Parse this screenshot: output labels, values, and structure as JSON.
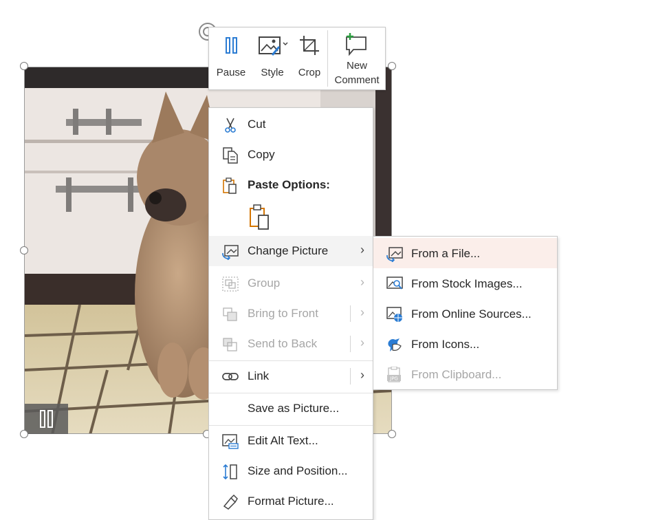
{
  "toolbar": {
    "pause_label": "Pause",
    "style_label": "Style",
    "crop_label": "Crop",
    "new_comment_line1": "New",
    "new_comment_line2": "Comment"
  },
  "context_menu": {
    "cut": "Cut",
    "copy": "Copy",
    "paste_options": "Paste Options:",
    "change_picture": "Change Picture",
    "group": "Group",
    "bring_to_front": "Bring to Front",
    "send_to_back": "Send to Back",
    "link": "Link",
    "save_as_picture": "Save as Picture...",
    "edit_alt_text": "Edit Alt Text...",
    "size_and_position": "Size and Position...",
    "format_picture": "Format Picture..."
  },
  "submenu": {
    "from_file": "From a File...",
    "from_stock": "From Stock Images...",
    "from_online": "From Online Sources...",
    "from_icons": "From Icons...",
    "from_clipboard": "From Clipboard..."
  },
  "icons": {
    "rotate": "rotate-handle-icon",
    "pause": "pause-icon",
    "style": "picture-style-icon",
    "crop": "crop-icon",
    "new_comment": "new-comment-icon",
    "cut": "scissors-icon",
    "copy": "copy-icon",
    "paste": "clipboard-icon",
    "change_picture": "change-picture-icon",
    "group": "group-icon",
    "bring_to_front": "bring-to-front-icon",
    "send_to_back": "send-to-back-icon",
    "link": "link-icon",
    "edit_alt_text": "alt-text-icon",
    "size_position": "size-position-icon",
    "format_picture": "format-picture-icon",
    "from_file": "picture-file-icon",
    "from_stock": "stock-images-icon",
    "from_online": "online-picture-icon",
    "from_icons": "bird-icon",
    "from_clipboard": "jpg-clipboard-icon"
  },
  "colors": {
    "accent_blue": "#2b7cd3",
    "paste_orange": "#d47500",
    "comment_green": "#2a9d3f",
    "submenu_hover": "#fbeeea",
    "disabled_text": "#a6a6a6"
  }
}
